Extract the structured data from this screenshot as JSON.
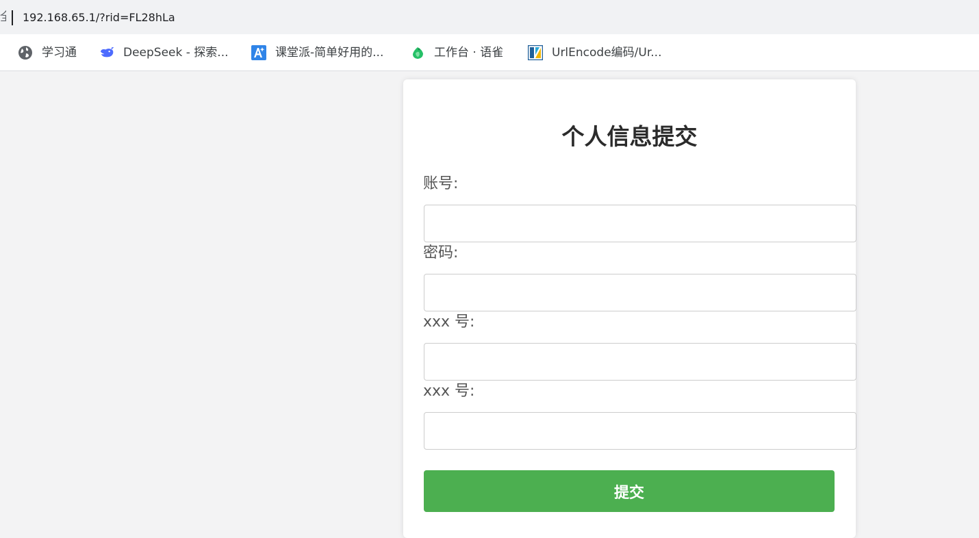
{
  "address_bar": {
    "security_fragment": "全",
    "url": "192.168.65.1/?rid=FL28hLa"
  },
  "bookmarks": [
    {
      "label": "学习通",
      "icon": "globe-icon"
    },
    {
      "label": "DeepSeek - 探索...",
      "icon": "deepseek-whale-icon"
    },
    {
      "label": "课堂派-简单好用的...",
      "icon": "ketangpai-icon"
    },
    {
      "label": "工作台 · 语雀",
      "icon": "yuque-icon"
    },
    {
      "label": "UrlEncode编码/Ur...",
      "icon": "urlencode-icon"
    }
  ],
  "form": {
    "title": "个人信息提交",
    "fields": [
      {
        "label": "账号:",
        "value": "",
        "placeholder": ""
      },
      {
        "label": "密码:",
        "value": "",
        "placeholder": ""
      },
      {
        "label": "xxx 号:",
        "value": "",
        "placeholder": ""
      },
      {
        "label": "xxx 号:",
        "value": "",
        "placeholder": ""
      }
    ],
    "submit_label": "提交"
  },
  "colors": {
    "page_background": "#f3f3f4",
    "submit_button": "#4caf50",
    "title_text": "#2b2b2b",
    "label_text": "#555555"
  }
}
